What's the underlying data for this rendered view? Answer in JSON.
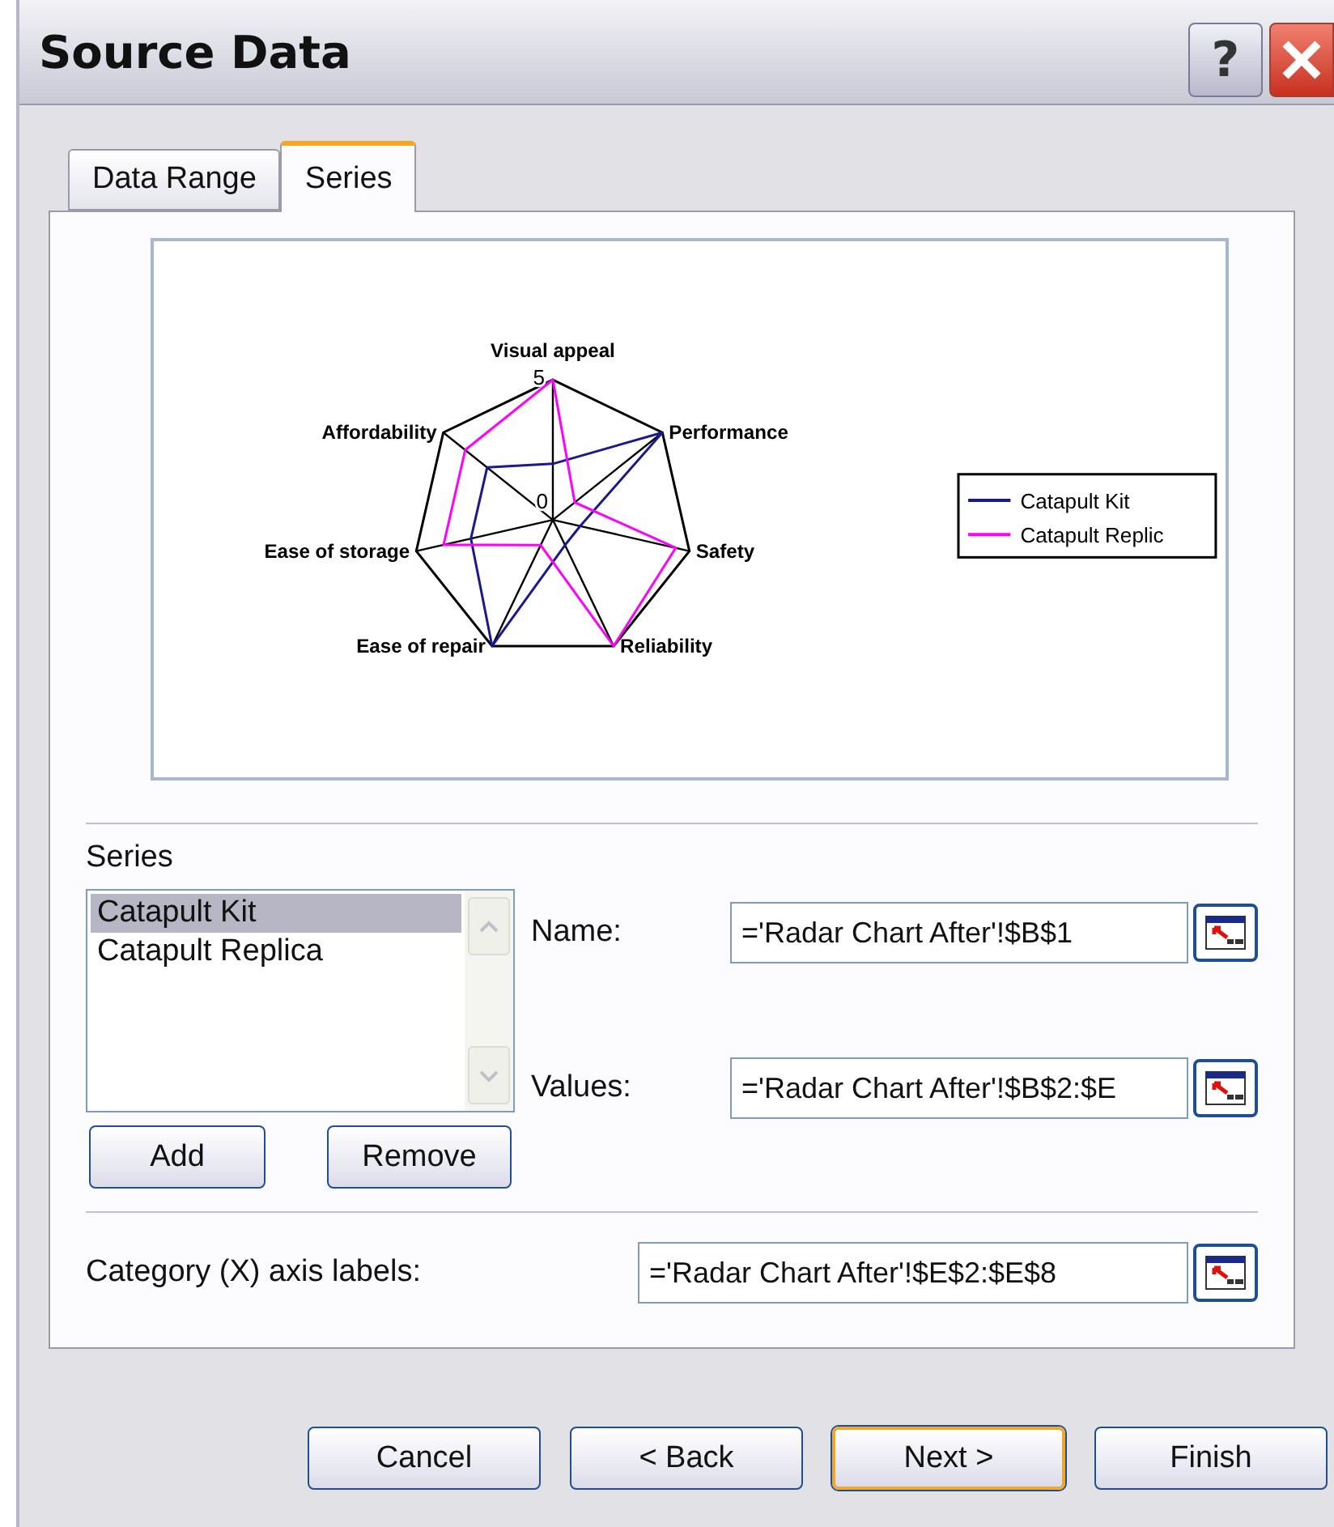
{
  "window": {
    "title": "Source Data",
    "buttons": [
      {
        "kind": "help",
        "label": "?"
      },
      {
        "kind": "close"
      }
    ]
  },
  "tabs": [
    {
      "label": "Data Range",
      "selected": false
    },
    {
      "label": "Series",
      "selected": true
    }
  ],
  "preview": {
    "chart_data": {
      "type": "radar",
      "categories": [
        "Visual appeal",
        "Performance",
        "Safety",
        "Reliability",
        "Ease of repair",
        "Ease of storage",
        "Affordability"
      ],
      "yticks": [
        0,
        5
      ],
      "ylim": [
        0,
        5
      ],
      "legend": true,
      "series": [
        {
          "name": "Catapult Kit",
          "color": "#1a1a8c",
          "values": [
            2,
            5,
            1,
            1,
            5,
            3,
            3
          ]
        },
        {
          "name": "Catapult Replic",
          "color": "#ff00ff",
          "values": [
            5,
            1,
            4.5,
            5,
            1,
            4,
            4
          ]
        }
      ]
    }
  },
  "series_section": {
    "label": "Series",
    "items": [
      {
        "label": "Catapult Kit",
        "selected": true
      },
      {
        "label": "Catapult Replica",
        "selected": false
      }
    ],
    "buttons": [
      {
        "label": "Add"
      },
      {
        "label": "Remove"
      }
    ]
  },
  "fields": [
    {
      "label": "Name:",
      "value": "='Radar Chart After'!$B$1"
    },
    {
      "label": "Values:",
      "value": "='Radar Chart After'!$B$2:$E"
    }
  ],
  "category_field": {
    "label": "Category (X) axis labels:",
    "value": "='Radar Chart After'!$E$2:$E$8"
  },
  "footer_buttons": [
    {
      "label": "Cancel",
      "focused": false
    },
    {
      "label": "< Back",
      "focused": false
    },
    {
      "label": "Next >",
      "focused": true
    },
    {
      "label": "Finish",
      "focused": false
    }
  ]
}
